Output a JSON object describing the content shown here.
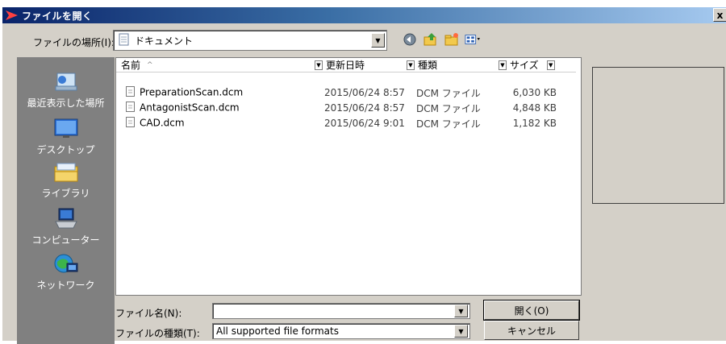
{
  "window": {
    "title": "ファイルを開く",
    "close_label": "x"
  },
  "lookin": {
    "label": "ファイルの場所(I):",
    "value": "ドキュメント"
  },
  "toolbar": {
    "icons": [
      "back-icon",
      "up-folder-icon",
      "new-folder-icon",
      "view-menu-icon"
    ]
  },
  "places": [
    {
      "label": "最近表示した場所",
      "icon": "recent-places-icon"
    },
    {
      "label": "デスクトップ",
      "icon": "desktop-icon"
    },
    {
      "label": "ライブラリ",
      "icon": "libraries-icon"
    },
    {
      "label": "コンピューター",
      "icon": "computer-icon"
    },
    {
      "label": "ネットワーク",
      "icon": "network-icon"
    }
  ],
  "columns": {
    "name": "名前",
    "date": "更新日時",
    "type": "種類",
    "size": "サイズ"
  },
  "files": [
    {
      "name": "PreparationScan.dcm",
      "date": "2015/06/24 8:57",
      "type": "DCM ファイル",
      "size": "6,030 KB"
    },
    {
      "name": "AntagonistScan.dcm",
      "date": "2015/06/24 8:57",
      "type": "DCM ファイル",
      "size": "4,848 KB"
    },
    {
      "name": "CAD.dcm",
      "date": "2015/06/24 9:01",
      "type": "DCM ファイル",
      "size": "1,182 KB"
    }
  ],
  "filename": {
    "label": "ファイル名(N):",
    "value": ""
  },
  "filetype": {
    "label": "ファイルの種類(T):",
    "value": "All supported file formats"
  },
  "buttons": {
    "open": "開く(O)",
    "cancel": "キャンセル"
  },
  "colors": {
    "title_start": "#0a246a",
    "title_end": "#a6caf0",
    "face": "#d4d0c8",
    "places_bg": "#808080"
  }
}
